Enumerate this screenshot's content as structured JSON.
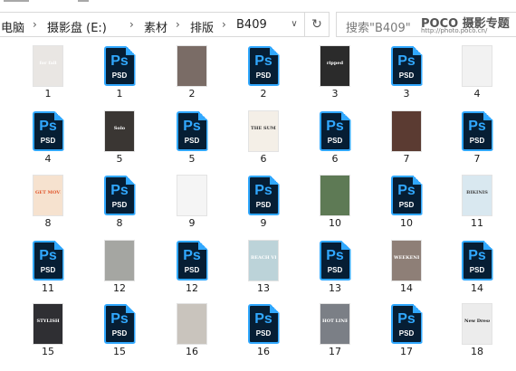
{
  "address_bar": {
    "crumbs": [
      "电脑",
      "摄影盘 (E:)",
      "素材",
      "排版",
      "B409"
    ],
    "dropdown_icon": "chevron-down-icon",
    "refresh_icon": "refresh-icon"
  },
  "search": {
    "placeholder": "搜索\"B409\""
  },
  "watermark": {
    "logo": "POCO 摄影专题",
    "url": "http://photo.poco.cn/"
  },
  "files": [
    {
      "label": "1",
      "type": "thumb",
      "bg": "#e9e6e3",
      "fg": "#ffffff",
      "text": "for fall"
    },
    {
      "label": "1",
      "type": "psd"
    },
    {
      "label": "2",
      "type": "thumb",
      "bg": "#7a6c66",
      "fg": "#ffffff",
      "text": ""
    },
    {
      "label": "2",
      "type": "psd"
    },
    {
      "label": "3",
      "type": "thumb",
      "bg": "#2b2b2b",
      "fg": "#ffffff",
      "text": "ripped"
    },
    {
      "label": "3",
      "type": "psd"
    },
    {
      "label": "4",
      "type": "thumb",
      "bg": "#f2f2f2",
      "fg": "#333333",
      "text": ""
    },
    {
      "label": "4",
      "type": "psd"
    },
    {
      "label": "5",
      "type": "thumb",
      "bg": "#3a3633",
      "fg": "#ffffff",
      "text": "Solo"
    },
    {
      "label": "5",
      "type": "psd"
    },
    {
      "label": "6",
      "type": "thumb",
      "bg": "#f4efe7",
      "fg": "#333333",
      "text": "THE SUMMER TRENDS"
    },
    {
      "label": "6",
      "type": "psd"
    },
    {
      "label": "7",
      "type": "thumb",
      "bg": "#5b3b32",
      "fg": "#ffffff",
      "text": ""
    },
    {
      "label": "7",
      "type": "psd"
    },
    {
      "label": "8",
      "type": "thumb",
      "bg": "#f6e2cf",
      "fg": "#e0552b",
      "text": "GET MOVING"
    },
    {
      "label": "8",
      "type": "psd"
    },
    {
      "label": "9",
      "type": "thumb",
      "bg": "#f5f5f5",
      "fg": "#444444",
      "text": ""
    },
    {
      "label": "9",
      "type": "psd"
    },
    {
      "label": "10",
      "type": "thumb",
      "bg": "#5e7a55",
      "fg": "#ffffff",
      "text": ""
    },
    {
      "label": "10",
      "type": "psd"
    },
    {
      "label": "11",
      "type": "thumb",
      "bg": "#d9e8f0",
      "fg": "#444444",
      "text": "BIKINIS"
    },
    {
      "label": "11",
      "type": "psd"
    },
    {
      "label": "12",
      "type": "thumb",
      "bg": "#a5a6a2",
      "fg": "#ffffff",
      "text": ""
    },
    {
      "label": "12",
      "type": "psd"
    },
    {
      "label": "13",
      "type": "thumb",
      "bg": "#bcd3d9",
      "fg": "#ffffff",
      "text": "BEACH VIBES"
    },
    {
      "label": "13",
      "type": "psd"
    },
    {
      "label": "14",
      "type": "thumb",
      "bg": "#8e7f77",
      "fg": "#ffffff",
      "text": "WEEKENDER"
    },
    {
      "label": "14",
      "type": "psd"
    },
    {
      "label": "15",
      "type": "thumb",
      "bg": "#2f2f33",
      "fg": "#ffffff",
      "text": "STYLISH"
    },
    {
      "label": "15",
      "type": "psd"
    },
    {
      "label": "16",
      "type": "thumb",
      "bg": "#c9c4bd",
      "fg": "#ffffff",
      "text": ""
    },
    {
      "label": "16",
      "type": "psd"
    },
    {
      "label": "17",
      "type": "thumb",
      "bg": "#7b7f86",
      "fg": "#ffffff",
      "text": "HOT LINE"
    },
    {
      "label": "17",
      "type": "psd"
    },
    {
      "label": "18",
      "type": "thumb",
      "bg": "#ececec",
      "fg": "#222222",
      "text": "New Dresses."
    }
  ]
}
